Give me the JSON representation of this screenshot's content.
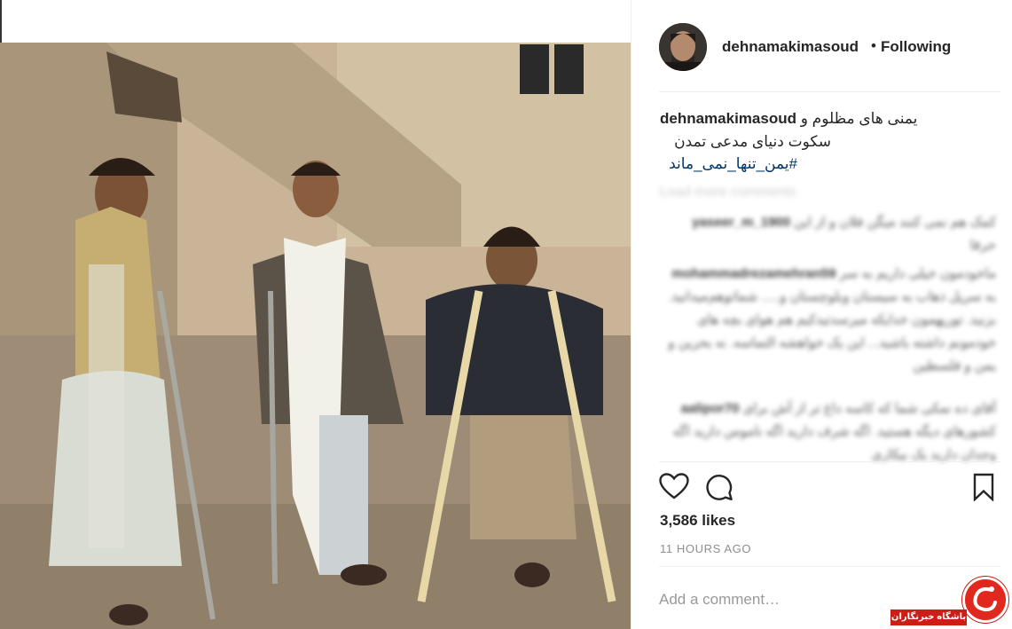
{
  "post": {
    "photo_alt": "",
    "author": {
      "username": "dehnamakimasoud",
      "separator": "•",
      "follow_status": "Following"
    },
    "caption": {
      "username": "dehnamakimasoud",
      "line1": "یمنی های مظلوم و",
      "line2": "سکوت دنیای مدعی تمدن",
      "hashtag": "#یمن_تنها_نمی_ماند"
    },
    "comments_blurred": {
      "load_more": "Load more comments",
      "items": [
        {
          "user": "yaseer_m_1900",
          "text": "کمک هم نمی کنند میگن فلان و از این حرفا"
        },
        {
          "user": "mohammadrezamehran59",
          "text": "ماخودمون خیلی داریم به سر به سرپل ذهاب به سیستان وبلوچستان و..... شماتوهم‌میدانید. بزنید. تورپهمون خدایکه میرسدتیدکیم هم هوای بچه های خودمونم داشته باشید... این یک خواهشه التماسه. نه بحرین و یمن و فلسطین"
        },
        {
          "user": "aalipor70",
          "text": "آقای ده نمکی شما که کاسه داغ تر از آش برای کشورهای دیگه هستید. اگه شرف دارید اگه ناموس دارید اگه وجدان دارید یک بیکاری"
        }
      ]
    },
    "actions": {
      "like_icon": "heart-icon",
      "comment_icon": "comment-icon",
      "save_icon": "bookmark-icon"
    },
    "likes": "3,586 likes",
    "time_ago": "11 HOURS AGO",
    "add_comment_placeholder": "Add a comment…"
  },
  "watermark": {
    "text": "باشگاه خبرنگاران",
    "colors": {
      "red": "#e0281e",
      "strip": "#c91f17"
    }
  },
  "colors": {
    "text": "#262626",
    "secondary": "#8e8e8e",
    "hashtag": "#003569",
    "divider": "#efefef"
  }
}
